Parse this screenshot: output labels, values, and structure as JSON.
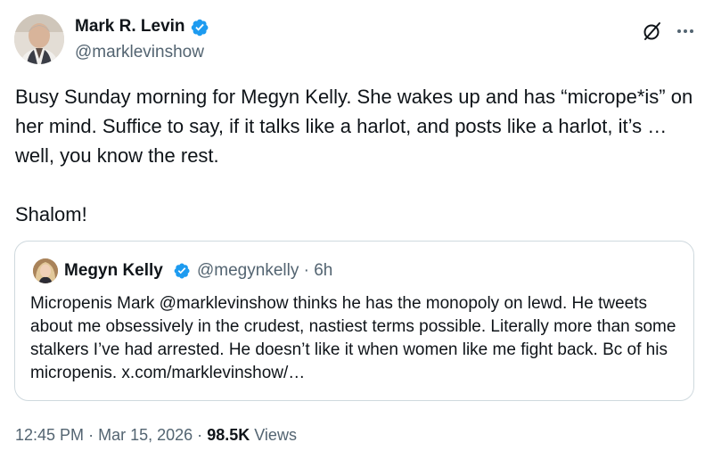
{
  "author": {
    "name": "Mark R. Levin",
    "handle": "@marklevinshow",
    "verified": true
  },
  "post": {
    "text": "Busy Sunday morning for Megyn Kelly. She wakes up and has “micrope*is” on her mind.  Suffice to say, if it talks like a harlot, and posts like a harlot, it’s … well, you know the rest.\n\nShalom!"
  },
  "quoted_post": {
    "author_name": "Megyn Kelly",
    "handle": "@megynkelly",
    "separator": "·",
    "time": "6h",
    "verified": true,
    "text": "Micropenis Mark @marklevinshow thinks he has the monopoly on lewd. He tweets about me obsessively in the crudest, nastiest terms possible. Literally more than some stalkers I’ve had arrested. He doesn’t like it when women like me fight back. Bc of his micropenis. x.com/marklevinshow/…"
  },
  "footer": {
    "time": "12:45 PM",
    "dot1": "·",
    "date": "Mar 15, 2026",
    "dot2": "·",
    "views_count": "98.5K",
    "views_label": "Views"
  },
  "icons": {
    "verified": "verified-badge-icon",
    "grok": "grok-icon",
    "more": "more-options-icon"
  },
  "colors": {
    "text": "#0f1419",
    "secondary": "#536471",
    "verified": "#1d9bf0",
    "border": "#cfd9de"
  }
}
